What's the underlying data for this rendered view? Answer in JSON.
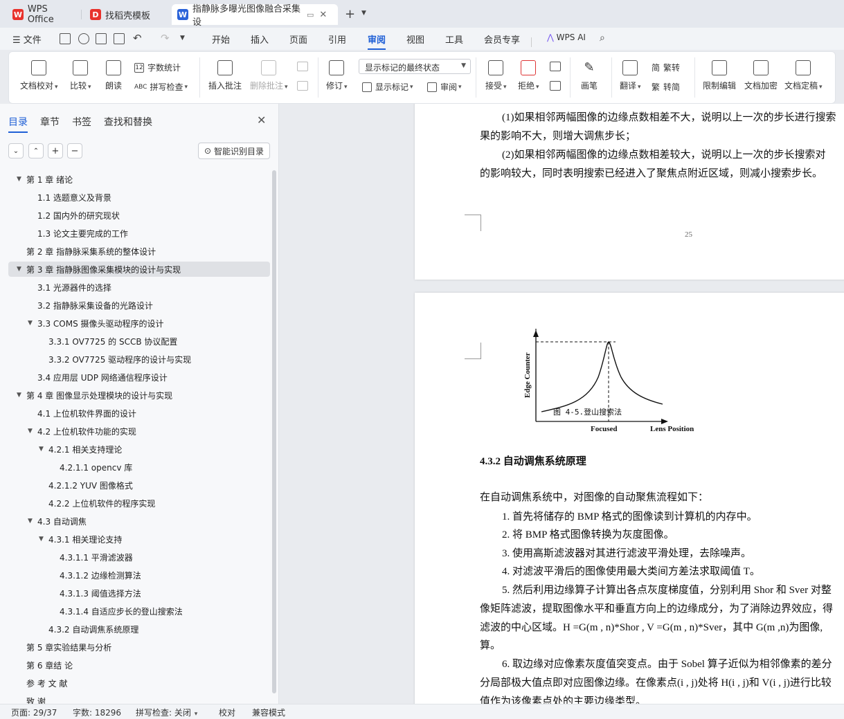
{
  "tabs": [
    {
      "label": "WPS Office"
    },
    {
      "label": "找稻壳模板"
    },
    {
      "label": "指静脉多曝光图像融合采集设"
    }
  ],
  "menu": {
    "file": "文件",
    "items": [
      "开始",
      "插入",
      "页面",
      "引用",
      "审阅",
      "视图",
      "工具",
      "会员专享"
    ],
    "active": "审阅",
    "wps_ai": "WPS AI"
  },
  "ribbon": {
    "doc_check": "文档校对",
    "compare": "比较",
    "read_aloud": "朗读",
    "word_count": "字数统计",
    "spell_check": "拼写检查",
    "insert_comment": "插入批注",
    "delete_comment": "删除批注",
    "revise": "修订",
    "markup_state": "显示标记的最终状态",
    "show_markup": "显示标记",
    "review": "审阅",
    "accept": "接受",
    "reject": "拒绝",
    "pen": "画笔",
    "translate": "翻译",
    "to_traditional": "繁转",
    "to_simplified": "转简",
    "trad_char": "简",
    "simp_char": "繁",
    "restrict_edit": "限制编辑",
    "encrypt": "文档加密",
    "finalize": "文档定稿"
  },
  "nav": {
    "tabs": [
      "目录",
      "章节",
      "书签",
      "查找和替换"
    ],
    "smart_button": "智能识别目录",
    "toc": [
      {
        "label": "第 1 章  绪论",
        "level": 0,
        "expanded": true
      },
      {
        "label": "1.1  选题意义及背景",
        "level": 1
      },
      {
        "label": "1.2  国内外的研究现状",
        "level": 1
      },
      {
        "label": "1.3  论文主要完成的工作",
        "level": 1
      },
      {
        "label": "第 2 章  指静脉采集系统的整体设计",
        "level": 0
      },
      {
        "label": "第 3 章  指静脉图像采集模块的设计与实现",
        "level": 0,
        "expanded": true,
        "selected": true
      },
      {
        "label": "3.1  光源器件的选择",
        "level": 1
      },
      {
        "label": "3.2  指静脉采集设备的光路设计",
        "level": 1
      },
      {
        "label": "3.3 COMS 摄像头驱动程序的设计",
        "level": 1,
        "expanded": true
      },
      {
        "label": "3.3.1 OV7725 的 SCCB 协议配置",
        "level": 2
      },
      {
        "label": "3.3.2 OV7725 驱动程序的设计与实现",
        "level": 2
      },
      {
        "label": "3.4  应用层 UDP 网络通信程序设计",
        "level": 1
      },
      {
        "label": "第 4 章  图像显示处理模块的设计与实现",
        "level": 0,
        "expanded": true
      },
      {
        "label": "4.1  上位机软件界面的设计",
        "level": 1
      },
      {
        "label": "4.2  上位机软件功能的实现",
        "level": 1,
        "expanded": true
      },
      {
        "label": "4.2.1  相关支持理论",
        "level": 2,
        "expanded": true
      },
      {
        "label": "4.2.1.1  opencv 库",
        "level": 3
      },
      {
        "label": "4.2.1.2 YUV 图像格式",
        "level": 2
      },
      {
        "label": "4.2.2  上位机软件的程序实现",
        "level": 2
      },
      {
        "label": "4.3  自动调焦",
        "level": 1,
        "expanded": true
      },
      {
        "label": "4.3.1  相关理论支持",
        "level": 2,
        "expanded": true
      },
      {
        "label": "4.3.1.1  平滑滤波器",
        "level": 3
      },
      {
        "label": "4.3.1.2  边缘检测算法",
        "level": 3
      },
      {
        "label": "4.3.1.3 阈值选择方法",
        "level": 3
      },
      {
        "label": "4.3.1.4  自适应步长的登山搜索法",
        "level": 3
      },
      {
        "label": "4.3.2 自动调焦系统原理",
        "level": 2
      },
      {
        "label": "第 5 章实验结果与分析",
        "level": 0
      },
      {
        "label": "第 6 章结  论",
        "level": 0
      },
      {
        "label": "参  考  文  献",
        "level": 0
      },
      {
        "label": "致    谢",
        "level": 0
      }
    ]
  },
  "page1": {
    "lines": [
      "(1)如果相邻两幅图像的边缘点数相差不大，说明以上一次的步长进行搜索",
      "果的影响不大，则增大调焦步长；",
      "(2)如果相邻两幅图像的边缘点数相差较大，说明以上一次的步长搜索对",
      "的影响较大，同时表明搜索已经进入了聚焦点附近区域，则减小搜索步长。"
    ],
    "page_number": "25"
  },
  "figure": {
    "ylabel": "Edge Counter",
    "xlabel_focused": "Focused",
    "xlabel_end": "Lens Position",
    "caption": "图 4-5.登山搜索法"
  },
  "page2": {
    "heading": "4.3.2 自动调焦系统原理",
    "intro": "在自动调焦系统中，对图像的自动聚焦流程如下：",
    "items": [
      "1.   首先将储存的 BMP 格式的图像读到计算机的内存中。",
      "2.   将 BMP 格式图像转换为灰度图像。",
      "3.   使用高斯滤波器对其进行滤波平滑处理，去除噪声。",
      "4.   对滤波平滑后的图像使用最大类间方差法求取阈值 T。",
      "5.   然后利用边缘算子计算出各点灰度梯度值，分别利用 Shor 和 Sver 对整"
    ],
    "cont": [
      "像矩阵滤波，提取图像水平和垂直方向上的边缘成分，为了消除边界效应，得",
      "滤波的中心区域。H =G(m , n)*Shor , V =G(m , n)*Sver，其中 G(m ,n)为图像,",
      "算。"
    ],
    "item6": "6.   取边缘对应像素灰度值突变点。由于 Sobel 算子近似为相邻像素的差分",
    "cont6": [
      "分局部极大值点即对应图像边缘。在像素点(i , j)处将 H(i , j)和 V(i , j)进行比较",
      "值作为该像素点处的主要边缘类型。"
    ]
  },
  "status": {
    "page": "页面: 29/37",
    "words": "字数: 18296",
    "spell": "拼写检查: 关闭",
    "proof": "校对",
    "compat": "兼容模式"
  },
  "colors": {
    "accent": "#1f5fd6",
    "wps_red": "#e8322c",
    "doc_blue": "#2b63d9"
  }
}
